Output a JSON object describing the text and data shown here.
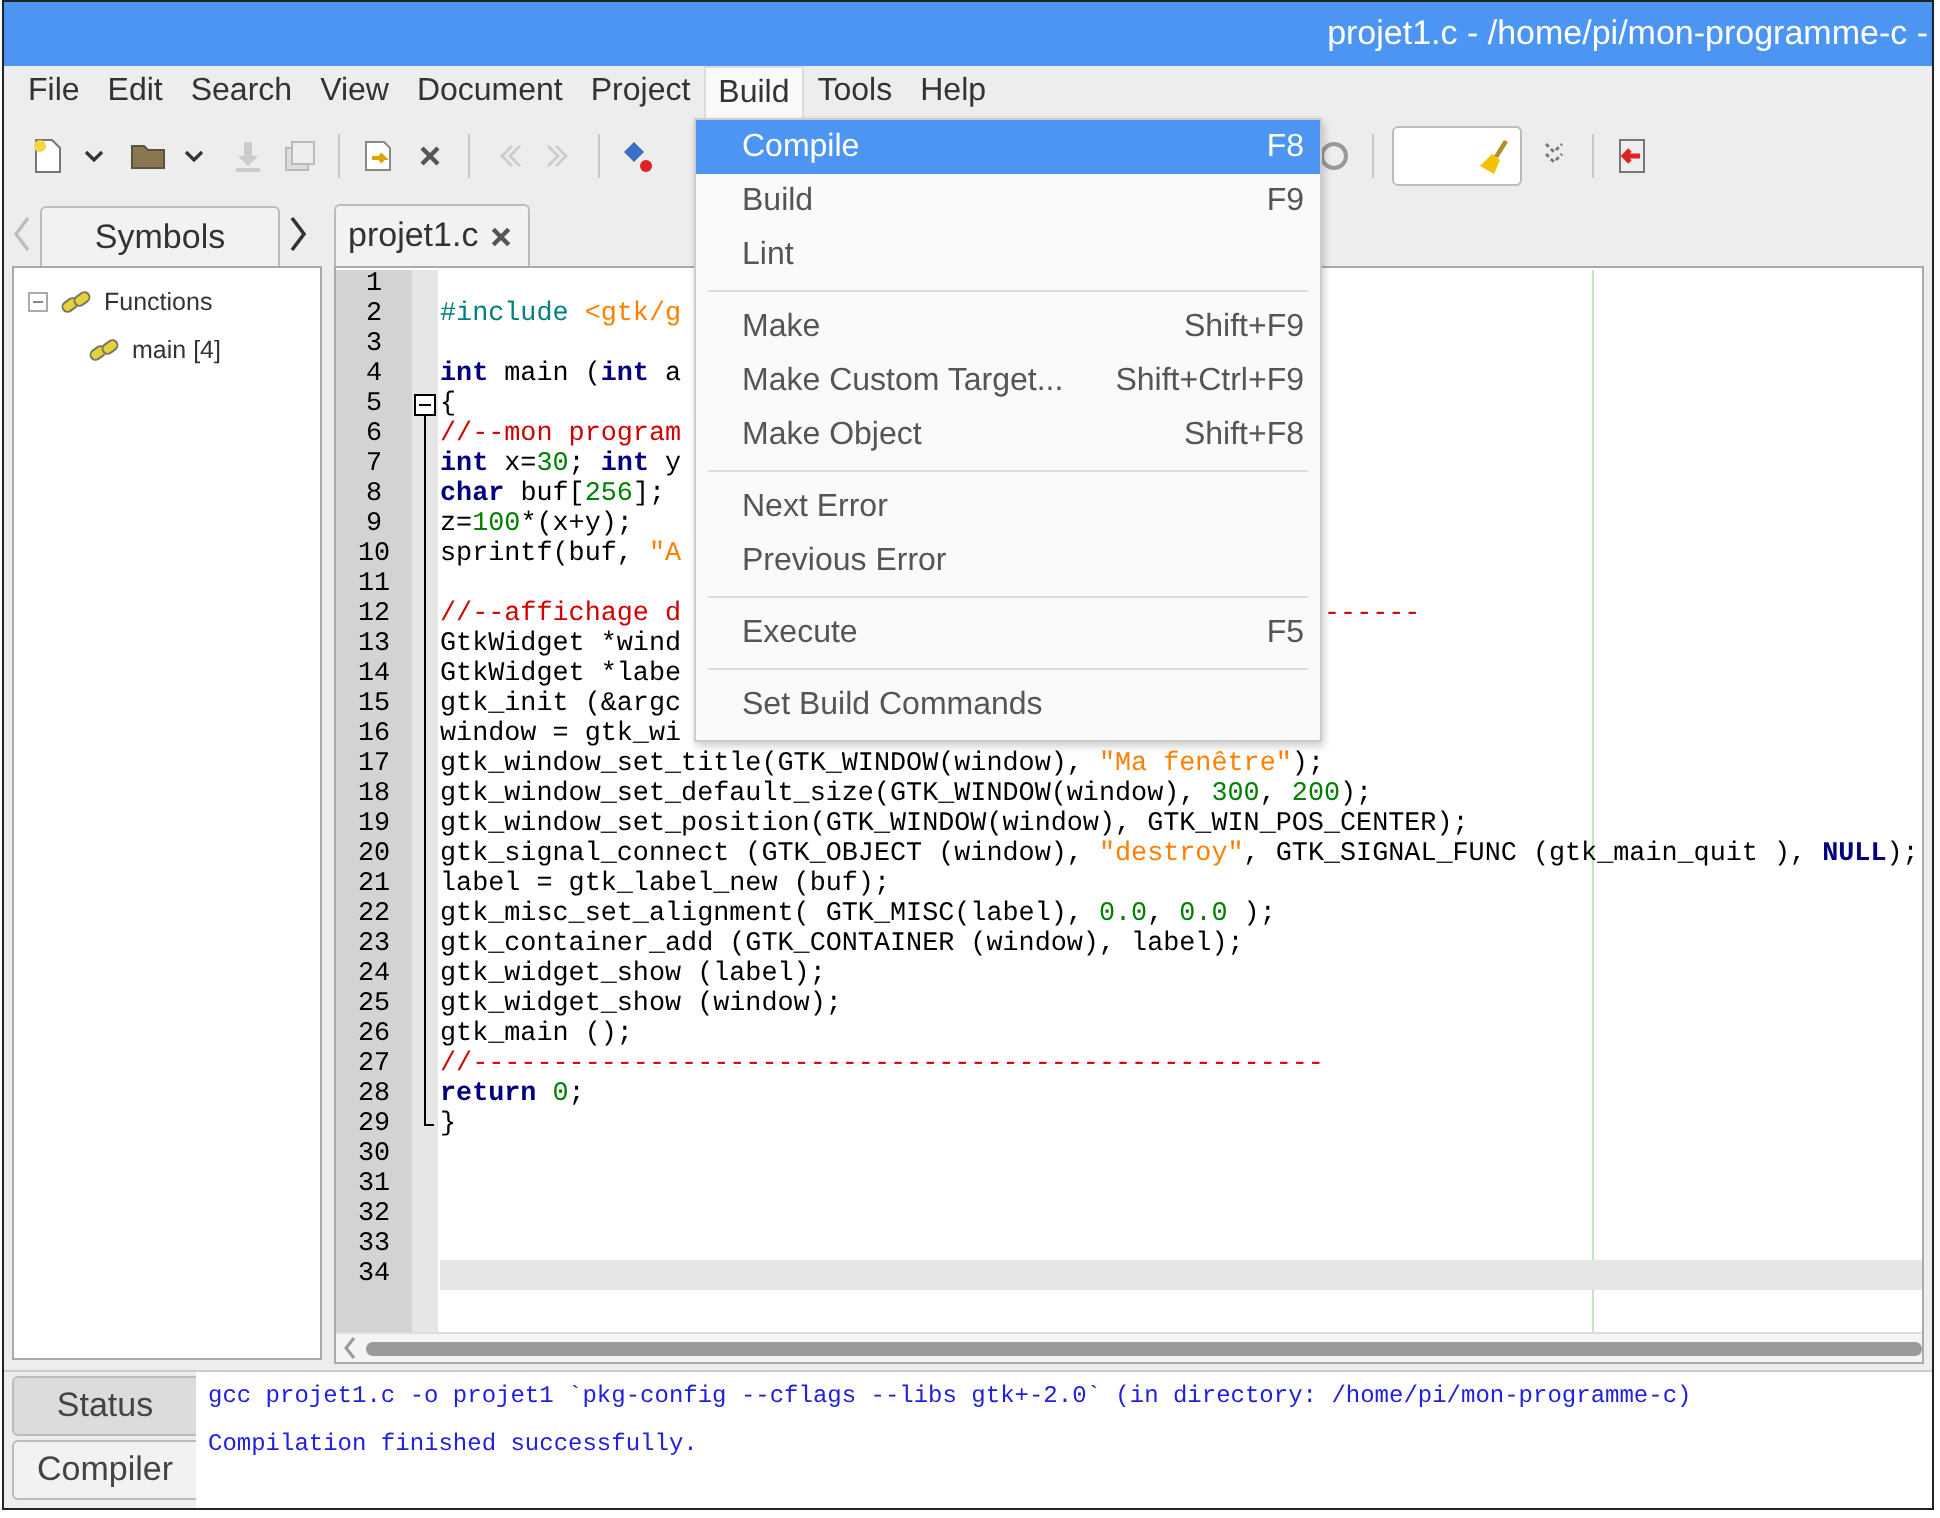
{
  "window": {
    "title": "projet1.c - /home/pi/mon-programme-c -"
  },
  "menubar": [
    {
      "label": "File",
      "selected": false
    },
    {
      "label": "Edit",
      "selected": false
    },
    {
      "label": "Search",
      "selected": false
    },
    {
      "label": "View",
      "selected": false
    },
    {
      "label": "Document",
      "selected": false
    },
    {
      "label": "Project",
      "selected": false
    },
    {
      "label": "Build",
      "selected": true
    },
    {
      "label": "Tools",
      "selected": false
    },
    {
      "label": "Help",
      "selected": false
    }
  ],
  "sidebar": {
    "tabs": [
      {
        "label": "Symbols",
        "selected": true
      }
    ],
    "tree": [
      {
        "label": "Functions",
        "expanded": true,
        "children": [
          {
            "label": "main [4]"
          }
        ]
      }
    ]
  },
  "editor": {
    "tabs": [
      {
        "label": "projet1.c",
        "selected": true
      }
    ],
    "lines": [
      {
        "n": "1",
        "current": false
      },
      {
        "n": "2",
        "current": false,
        "tokens": [
          {
            "kind": "preproc",
            "text": "#include "
          },
          {
            "kind": "string",
            "text": "<gtk/g"
          }
        ]
      },
      {
        "n": "3",
        "current": false
      },
      {
        "n": "4",
        "current": false,
        "tokens": [
          {
            "kind": "keyword",
            "text": "int"
          },
          {
            "kind": "plain",
            "text": " main ("
          },
          {
            "kind": "keyword",
            "text": "int"
          },
          {
            "kind": "plain",
            "text": " a"
          }
        ]
      },
      {
        "n": "5",
        "current": false,
        "tokens": [
          {
            "kind": "plain",
            "text": "{"
          }
        ]
      },
      {
        "n": "6",
        "current": false,
        "tokens": [
          {
            "kind": "comment",
            "text": "//--mon program"
          }
        ]
      },
      {
        "n": "7",
        "current": false,
        "tokens": [
          {
            "kind": "keyword",
            "text": "int"
          },
          {
            "kind": "plain",
            "text": " x="
          },
          {
            "kind": "number",
            "text": "30"
          },
          {
            "kind": "plain",
            "text": "; "
          },
          {
            "kind": "keyword",
            "text": "int"
          },
          {
            "kind": "plain",
            "text": " y"
          }
        ]
      },
      {
        "n": "8",
        "current": false,
        "tokens": [
          {
            "kind": "keyword",
            "text": "char"
          },
          {
            "kind": "plain",
            "text": " buf["
          },
          {
            "kind": "number",
            "text": "256"
          },
          {
            "kind": "plain",
            "text": "];"
          }
        ]
      },
      {
        "n": "9",
        "current": false,
        "tokens": [
          {
            "kind": "plain",
            "text": "z="
          },
          {
            "kind": "number",
            "text": "100"
          },
          {
            "kind": "plain",
            "text": "*(x+y);"
          }
        ]
      },
      {
        "n": "10",
        "current": false,
        "tokens": [
          {
            "kind": "plain",
            "text": "sprintf(buf, "
          },
          {
            "kind": "string",
            "text": "\"A"
          }
        ]
      },
      {
        "n": "11",
        "current": false
      },
      {
        "n": "12",
        "current": false,
        "tokens": [
          {
            "kind": "comment",
            "text": "//--affichage d"
          }
        ],
        "tail": {
          "kind": "comment",
          "text": "------"
        }
      },
      {
        "n": "13",
        "current": false,
        "tokens": [
          {
            "kind": "plain",
            "text": "GtkWidget *wind"
          }
        ]
      },
      {
        "n": "14",
        "current": false,
        "tokens": [
          {
            "kind": "plain",
            "text": "GtkWidget *labe"
          }
        ]
      },
      {
        "n": "15",
        "current": false,
        "tokens": [
          {
            "kind": "plain",
            "text": "gtk_init (&argc"
          }
        ]
      },
      {
        "n": "16",
        "current": false,
        "tokens": [
          {
            "kind": "plain",
            "text": "window = gtk_wi"
          }
        ]
      },
      {
        "n": "17",
        "current": false,
        "tokens": [
          {
            "kind": "plain",
            "text": "gtk_window_set_title(GTK_WINDOW(window), "
          },
          {
            "kind": "string",
            "text": "\"Ma fenêtre\""
          },
          {
            "kind": "plain",
            "text": ");"
          }
        ]
      },
      {
        "n": "18",
        "current": false,
        "tokens": [
          {
            "kind": "plain",
            "text": "gtk_window_set_default_size(GTK_WINDOW(window), "
          },
          {
            "kind": "number",
            "text": "300"
          },
          {
            "kind": "plain",
            "text": ", "
          },
          {
            "kind": "number",
            "text": "200"
          },
          {
            "kind": "plain",
            "text": ");"
          }
        ]
      },
      {
        "n": "19",
        "current": false,
        "tokens": [
          {
            "kind": "plain",
            "text": "gtk_window_set_position(GTK_WINDOW(window), GTK_WIN_POS_CENTER);"
          }
        ]
      },
      {
        "n": "20",
        "current": false,
        "tokens": [
          {
            "kind": "plain",
            "text": "gtk_signal_connect (GTK_OBJECT (window), "
          },
          {
            "kind": "string",
            "text": "\"destroy\""
          },
          {
            "kind": "plain",
            "text": ", GTK_SIGNAL_FUNC (gtk_main_quit ), "
          },
          {
            "kind": "keyword",
            "text": "NULL"
          },
          {
            "kind": "plain",
            "text": ");"
          }
        ]
      },
      {
        "n": "21",
        "current": false,
        "tokens": [
          {
            "kind": "plain",
            "text": "label = gtk_label_new (buf);"
          }
        ]
      },
      {
        "n": "22",
        "current": false,
        "tokens": [
          {
            "kind": "plain",
            "text": "gtk_misc_set_alignment( GTK_MISC(label), "
          },
          {
            "kind": "number",
            "text": "0.0"
          },
          {
            "kind": "plain",
            "text": ", "
          },
          {
            "kind": "number",
            "text": "0.0"
          },
          {
            "kind": "plain",
            "text": " );"
          }
        ]
      },
      {
        "n": "23",
        "current": false,
        "tokens": [
          {
            "kind": "plain",
            "text": "gtk_container_add (GTK_CONTAINER (window), label);"
          }
        ]
      },
      {
        "n": "24",
        "current": false,
        "tokens": [
          {
            "kind": "plain",
            "text": "gtk_widget_show (label);"
          }
        ]
      },
      {
        "n": "25",
        "current": false,
        "tokens": [
          {
            "kind": "plain",
            "text": "gtk_widget_show (window);"
          }
        ]
      },
      {
        "n": "26",
        "current": false,
        "tokens": [
          {
            "kind": "plain",
            "text": "gtk_main ();"
          }
        ]
      },
      {
        "n": "27",
        "current": false,
        "tokens": [
          {
            "kind": "comment",
            "text": "//-----------------------------------------------------"
          }
        ]
      },
      {
        "n": "28",
        "current": false,
        "tokens": [
          {
            "kind": "keyword",
            "text": "return"
          },
          {
            "kind": "number",
            "text": " 0"
          },
          {
            "kind": "plain",
            "text": ";"
          }
        ]
      },
      {
        "n": "29",
        "current": false,
        "tokens": [
          {
            "kind": "plain",
            "text": "}"
          }
        ]
      },
      {
        "n": "30",
        "current": false
      },
      {
        "n": "31",
        "current": false
      },
      {
        "n": "32",
        "current": false
      },
      {
        "n": "33",
        "current": false
      },
      {
        "n": "34",
        "current": true
      }
    ]
  },
  "build_menu": {
    "groups": [
      [
        {
          "label": "Compile",
          "shortcut": "F8",
          "selected": true
        },
        {
          "label": "Build",
          "shortcut": "F9",
          "selected": false
        },
        {
          "label": "Lint",
          "selected": false
        }
      ],
      [
        {
          "label": "Make",
          "shortcut": "Shift+F9",
          "selected": false
        },
        {
          "label": "Make Custom Target...",
          "shortcut": "Shift+Ctrl+F9",
          "selected": false
        },
        {
          "label": "Make Object",
          "shortcut": "Shift+F8",
          "selected": false
        }
      ],
      [
        {
          "label": "Next Error",
          "selected": false
        },
        {
          "label": "Previous Error",
          "selected": false
        }
      ],
      [
        {
          "label": "Execute",
          "shortcut": "F5",
          "selected": false
        }
      ],
      [
        {
          "label": "Set Build Commands",
          "selected": false
        }
      ]
    ]
  },
  "messages": {
    "tabs": [
      {
        "label": "Status",
        "selected": false
      },
      {
        "label": "Compiler",
        "selected": true
      }
    ],
    "lines": [
      "gcc projet1.c -o projet1 `pkg-config --cflags --libs gtk+-2.0` (in directory: /home/pi/mon-programme-c)",
      "Compilation finished successfully."
    ]
  }
}
